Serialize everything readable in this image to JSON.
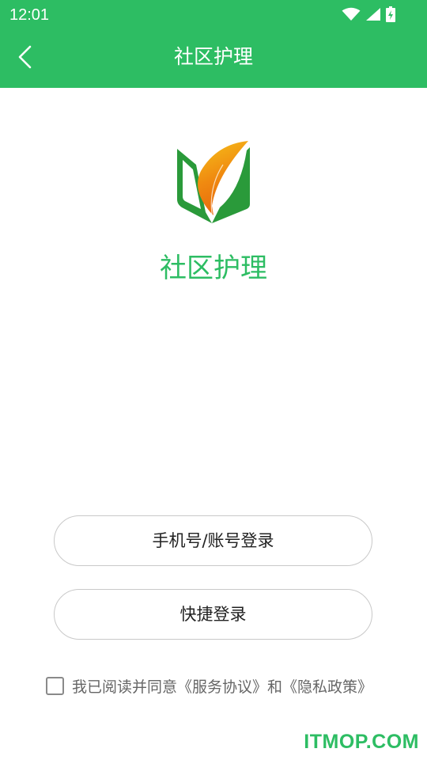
{
  "status_bar": {
    "time": "12:01",
    "icons": [
      "wifi-icon",
      "signal-icon",
      "battery-charging-icon"
    ]
  },
  "header": {
    "title": "社区护理",
    "back_icon": "chevron-left-icon",
    "color": "#2dbd63"
  },
  "app": {
    "name": "社区护理",
    "logo_icon": "leaf-book-logo"
  },
  "buttons": {
    "account_login": "手机号/账号登录",
    "quick_login": "快捷登录"
  },
  "agreement": {
    "checked": false,
    "prefix": "我已阅读并同意",
    "service": "《服务协议》",
    "and": "和",
    "privacy": "《隐私政策》"
  },
  "watermark": "ITMOP.COM"
}
